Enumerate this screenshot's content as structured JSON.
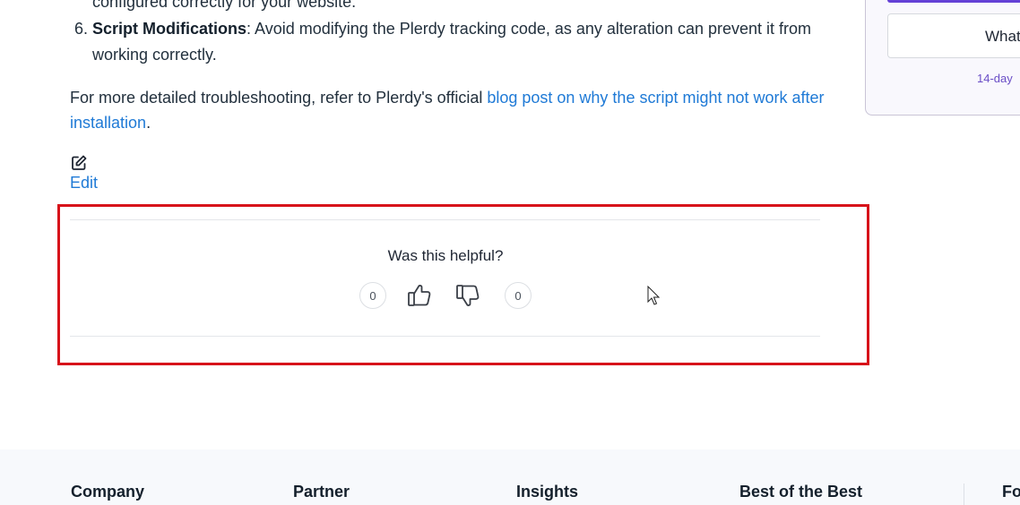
{
  "article": {
    "prev_line": "configured correctly for your website.",
    "list_item": {
      "number": "6.",
      "title": "Script Modifications",
      "text": ": Avoid modifying the Plerdy tracking code, as any alteration can prevent it from working correctly."
    },
    "paragraph": {
      "prefix": "For more detailed troubleshooting, refer to Plerdy's official ",
      "link_text": "blog post on why the script might not work after installation",
      "suffix": "."
    },
    "edit_label": "Edit"
  },
  "feedback": {
    "question": "Was this helpful?",
    "upvotes": "0",
    "downvotes": "0"
  },
  "sidebar": {
    "button_label": "What",
    "trial_text": "14-day"
  },
  "footer": {
    "columns": [
      "Company",
      "Partner",
      "Insights",
      "Best of the Best",
      "Fo"
    ]
  },
  "colors": {
    "link": "#1f7ad6",
    "highlight_border": "#d7121a",
    "accent_purple": "#6440d6"
  }
}
